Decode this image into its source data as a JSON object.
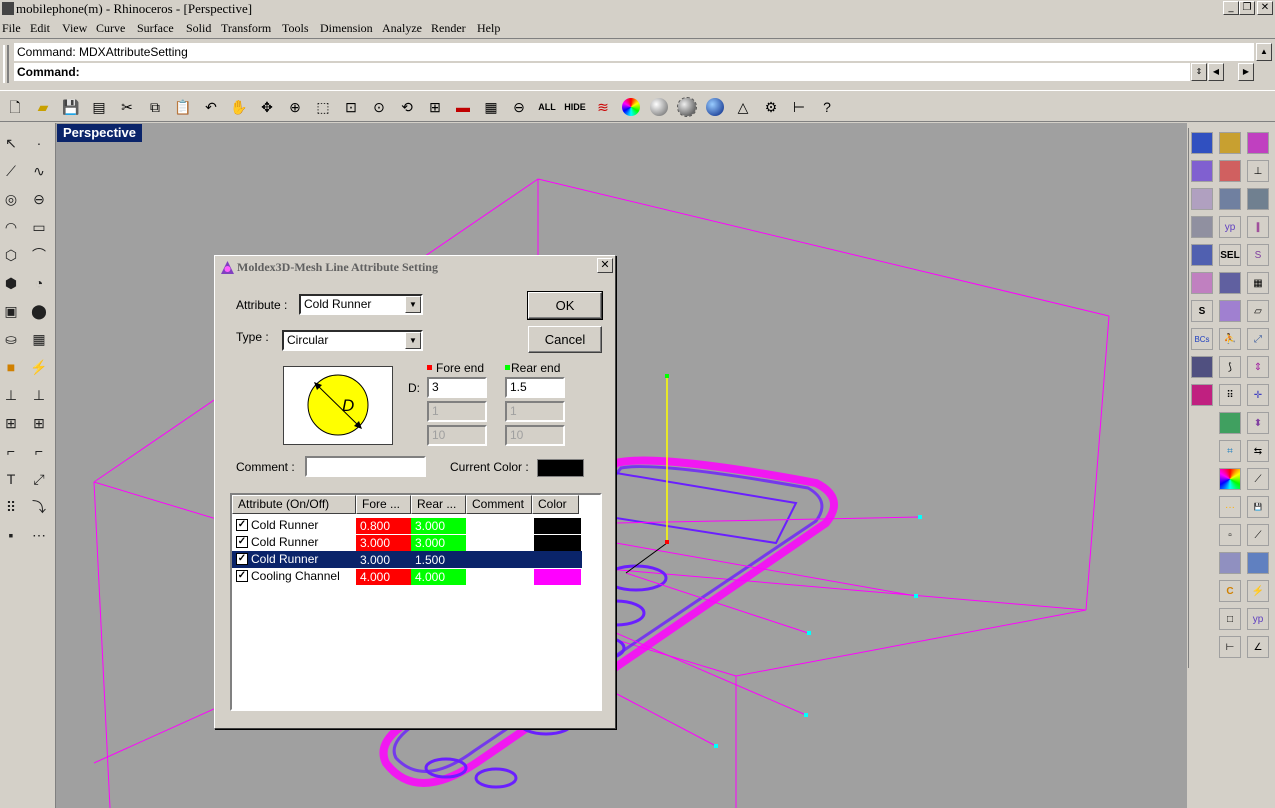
{
  "window": {
    "title": "mobilephone(m) - Rhinoceros - [Perspective]",
    "minimize": "_",
    "restore": "❐",
    "close": "✕"
  },
  "menu": [
    "File",
    "Edit",
    "View",
    "Curve",
    "Surface",
    "Solid",
    "Transform",
    "Tools",
    "Dimension",
    "Analyze",
    "Render",
    "Help"
  ],
  "command": {
    "history": "Command: MDXAttributeSetting",
    "prompt": "Command:"
  },
  "toolbar": {
    "all_label": "ALL",
    "hide_label": "HIDE"
  },
  "viewport": {
    "label": "Perspective"
  },
  "dialog": {
    "title": "Moldex3D-Mesh Line Attribute Setting",
    "attribute_label": "Attribute :",
    "attribute_value": "Cold Runner",
    "type_label": "Type :",
    "type_value": "Circular",
    "ok_label": "OK",
    "cancel_label": "Cancel",
    "fore_end_label": "Fore end",
    "rear_end_label": "Rear end",
    "d_label": "D:",
    "fore_d": "3",
    "rear_d": "1.5",
    "fore_2": "1",
    "rear_2": "1",
    "fore_3": "10",
    "rear_3": "10",
    "comment_label": "Comment :",
    "comment_value": "",
    "current_color_label": "Current Color :",
    "diagram_letter": "D",
    "list": {
      "columns": [
        "Attribute (On/Off)",
        "Fore ...",
        "Rear ...",
        "Comment",
        "Color"
      ],
      "rows": [
        {
          "name": "Cold Runner",
          "fore": "0.800",
          "rear": "3.000",
          "comment": "",
          "color": "#000000",
          "checked": true,
          "selected": false
        },
        {
          "name": "Cold Runner",
          "fore": "3.000",
          "rear": "3.000",
          "comment": "",
          "color": "#000000",
          "checked": true,
          "selected": false
        },
        {
          "name": "Cold Runner",
          "fore": "3.000",
          "rear": "1.500",
          "comment": "",
          "color": "#0a246a",
          "checked": true,
          "selected": true
        },
        {
          "name": "Cooling Channel",
          "fore": "4.000",
          "rear": "4.000",
          "comment": "",
          "color": "#ff00ff",
          "checked": true,
          "selected": false
        }
      ]
    },
    "check_mark": "✓"
  },
  "colors": {
    "viewport_bg": "#a0a0a0",
    "wire_magenta": "#ff00ff",
    "mesh_blue": "#6a1fff",
    "fore_cell": "#ff0000",
    "rear_cell": "#00ff00",
    "selection": "#0a246a"
  }
}
